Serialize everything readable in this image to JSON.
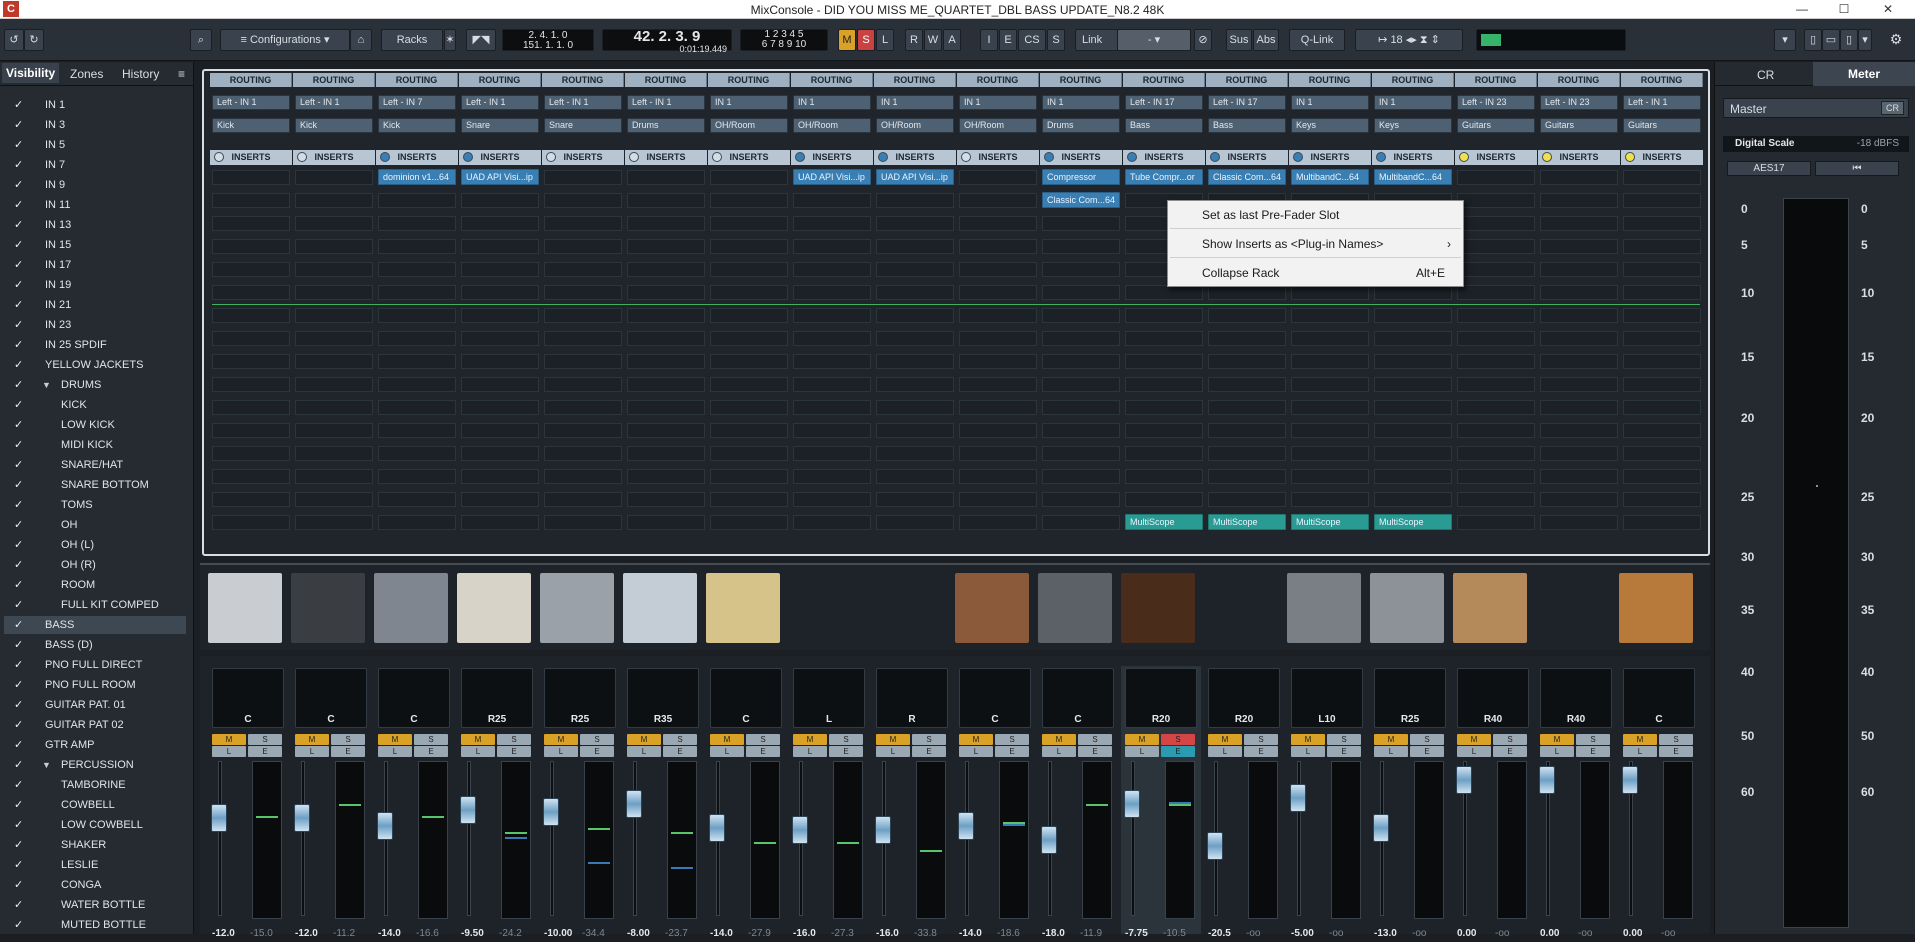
{
  "window": {
    "title": "MixConsole - DID YOU MISS ME_QUARTET_DBL BASS UPDATE_N8.2 48K",
    "minimize": "—",
    "maximize": "☐",
    "close": "✕"
  },
  "toolbar": {
    "configurations": "Configurations",
    "racks": "Racks",
    "pos1": "2. 4. 1.   0",
    "pos2": "151. 1. 1.   0",
    "bars": "42. 2. 3.   9",
    "time": "0:01:19.449",
    "nums1": "1 2 3 4 5",
    "nums2": "6 7 8 9 10",
    "m": "M",
    "s": "S",
    "l": "L",
    "r": "R",
    "w": "W",
    "a": "A",
    "i": "I",
    "e": "E",
    "cs": "CS",
    "s2": "S",
    "link": "Link",
    "linkval": "-",
    "sus": "Sus",
    "abs": "Abs",
    "qlink": "Q-Link",
    "zoom": "18"
  },
  "left_tabs": {
    "visibility": "Visibility",
    "zones": "Zones",
    "history": "History"
  },
  "tracks": [
    {
      "name": "IN 1",
      "c": "✓"
    },
    {
      "name": "IN 3",
      "c": "✓"
    },
    {
      "name": "IN 5",
      "c": "✓"
    },
    {
      "name": "IN 7",
      "c": "✓"
    },
    {
      "name": "IN 9",
      "c": "✓"
    },
    {
      "name": "IN 11",
      "c": "✓"
    },
    {
      "name": "IN 13",
      "c": "✓"
    },
    {
      "name": "IN 15",
      "c": "✓"
    },
    {
      "name": "IN 17",
      "c": "✓"
    },
    {
      "name": "IN 19",
      "c": "✓"
    },
    {
      "name": "IN 21",
      "c": "✓"
    },
    {
      "name": "IN 23",
      "c": "✓"
    },
    {
      "name": "IN 25   SPDIF",
      "c": "✓"
    },
    {
      "name": "YELLOW JACKETS",
      "c": "✓"
    },
    {
      "name": "DRUMS",
      "c": "✓",
      "fold": true
    },
    {
      "name": "KICK",
      "c": "✓",
      "sub": true
    },
    {
      "name": "LOW KICK",
      "c": "✓",
      "sub": true
    },
    {
      "name": "MIDI KICK",
      "c": "✓",
      "sub": true
    },
    {
      "name": "SNARE/HAT",
      "c": "✓",
      "sub": true
    },
    {
      "name": "SNARE BOTTOM",
      "c": "✓",
      "sub": true
    },
    {
      "name": "TOMS",
      "c": "✓",
      "sub": true
    },
    {
      "name": "OH",
      "c": "✓",
      "sub": true
    },
    {
      "name": "OH (L)",
      "c": "✓",
      "sub": true
    },
    {
      "name": "OH (R)",
      "c": "✓",
      "sub": true
    },
    {
      "name": "ROOM",
      "c": "✓",
      "sub": true
    },
    {
      "name": "FULL KIT COMPED",
      "c": "✓",
      "sub": true
    },
    {
      "name": "BASS",
      "c": "✓",
      "sel": true
    },
    {
      "name": "BASS (D)",
      "c": "✓"
    },
    {
      "name": "PNO FULL DIRECT",
      "c": "✓"
    },
    {
      "name": "PNO FULL  ROOM",
      "c": "✓"
    },
    {
      "name": "GUITAR PAT. 01",
      "c": "✓"
    },
    {
      "name": "GUITAR PAT 02",
      "c": "✓"
    },
    {
      "name": "GTR AMP",
      "c": "✓"
    },
    {
      "name": "PERCUSSION",
      "c": "✓",
      "fold": true
    },
    {
      "name": "TAMBORINE",
      "c": "✓",
      "sub": true
    },
    {
      "name": "COWBELL",
      "c": "✓",
      "sub": true
    },
    {
      "name": "LOW COWBELL",
      "c": "✓",
      "sub": true
    },
    {
      "name": "SHAKER",
      "c": "✓",
      "sub": true
    },
    {
      "name": "LESLIE",
      "c": "✓",
      "sub": true
    },
    {
      "name": "CONGA",
      "c": "✓",
      "sub": true
    },
    {
      "name": "WATER BOTTLE",
      "c": "✓",
      "sub": true
    },
    {
      "name": "MUTED BOTTLE",
      "c": "✓",
      "sub": true
    }
  ],
  "routing_label": "ROUTING",
  "inserts_label": "INSERTS",
  "channels": [
    {
      "in": "Left - IN 1",
      "name": "Kick",
      "pan": "C",
      "vol": "-12.0",
      "peak": "-15.0",
      "ins": "off"
    },
    {
      "in": "Left - IN 1",
      "name": "Kick",
      "pan": "C",
      "vol": "-12.0",
      "peak": "-11.2",
      "ins": "off"
    },
    {
      "in": "Left - IN 7",
      "name": "Kick",
      "pan": "C",
      "vol": "-14.0",
      "peak": "-16.6",
      "ins": "on"
    },
    {
      "in": "Left - IN 1",
      "name": "Snare",
      "pan": "R25",
      "vol": "-9.50",
      "peak": "-24.2",
      "ins": "on"
    },
    {
      "in": "Left - IN 1",
      "name": "Snare",
      "pan": "R25",
      "vol": "-10.00",
      "peak": "-34.4",
      "ins": "off"
    },
    {
      "in": "Left - IN 1",
      "name": "Drums",
      "pan": "R35",
      "vol": "-8.00",
      "peak": "-23.7",
      "ins": "off"
    },
    {
      "in": "IN 1",
      "name": "OH/Room",
      "pan": "C",
      "vol": "-14.0",
      "peak": "-27.9",
      "ins": "off"
    },
    {
      "in": "IN 1",
      "name": "OH/Room",
      "pan": "L",
      "vol": "-16.0",
      "peak": "-27.3",
      "ins": "on"
    },
    {
      "in": "IN 1",
      "name": "OH/Room",
      "pan": "R",
      "vol": "-16.0",
      "peak": "-33.8",
      "ins": "on"
    },
    {
      "in": "IN 1",
      "name": "OH/Room",
      "pan": "C",
      "vol": "-14.0",
      "peak": "-18.6",
      "ins": "off"
    },
    {
      "in": "IN 1",
      "name": "Drums",
      "pan": "C",
      "vol": "-18.0",
      "peak": "-11.9",
      "ins": "on"
    },
    {
      "in": "Left - IN 17",
      "name": "Bass",
      "pan": "R20",
      "vol": "-7.75",
      "peak": "-10.5",
      "ins": "on"
    },
    {
      "in": "Left - IN 17",
      "name": "Bass",
      "pan": "R20",
      "vol": "-20.5",
      "peak": "-oo",
      "ins": "on"
    },
    {
      "in": "IN 1",
      "name": "Keys",
      "pan": "L10",
      "vol": "-5.00",
      "peak": "-oo",
      "ins": "on"
    },
    {
      "in": "IN 1",
      "name": "Keys",
      "pan": "R25",
      "vol": "-13.0",
      "peak": "-oo",
      "ins": "on"
    },
    {
      "in": "Left - IN 23",
      "name": "Guitars",
      "pan": "R40",
      "vol": "0.00",
      "peak": "-oo",
      "ins": "yel"
    },
    {
      "in": "Left - IN 23",
      "name": "Guitars",
      "pan": "R40",
      "vol": "0.00",
      "peak": "-oo",
      "ins": "yel"
    },
    {
      "in": "Left - IN 1",
      "name": "Guitars",
      "pan": "C",
      "vol": "0.00",
      "peak": "-oo",
      "ins": "yel"
    }
  ],
  "plugins": [
    {
      "ch": 2,
      "slot": 0,
      "name": "dominion v1...64",
      "teal": false
    },
    {
      "ch": 3,
      "slot": 0,
      "name": "UAD API Visi...ip",
      "teal": false
    },
    {
      "ch": 7,
      "slot": 0,
      "name": "UAD API Visi...ip",
      "teal": false
    },
    {
      "ch": 8,
      "slot": 0,
      "name": "UAD API Visi...ip",
      "teal": false
    },
    {
      "ch": 10,
      "slot": 0,
      "name": "Compressor",
      "teal": false
    },
    {
      "ch": 10,
      "slot": 1,
      "name": "Classic Com...64",
      "teal": false
    },
    {
      "ch": 11,
      "slot": 0,
      "name": "Tube Compr...or",
      "teal": false
    },
    {
      "ch": 12,
      "slot": 0,
      "name": "Classic Com...64",
      "teal": false
    },
    {
      "ch": 13,
      "slot": 0,
      "name": "MultibandC...64",
      "teal": false
    },
    {
      "ch": 14,
      "slot": 0,
      "name": "MultibandC...64",
      "teal": false
    },
    {
      "ch": 11,
      "slot": 15,
      "name": "MultiScope",
      "teal": true
    },
    {
      "ch": 12,
      "slot": 15,
      "name": "MultiScope",
      "teal": true
    },
    {
      "ch": 13,
      "slot": 15,
      "name": "MultiScope",
      "teal": true
    },
    {
      "ch": 14,
      "slot": 15,
      "name": "MultiScope",
      "teal": true
    }
  ],
  "context_menu": {
    "item1": "Set as last Pre-Fader Slot",
    "item2": "Show Inserts as <Plug-in Names>",
    "item2_arrow": "›",
    "item3": "Collapse Rack",
    "item3_shortcut": "Alt+E"
  },
  "fader_buttons": {
    "m": "M",
    "s": "S",
    "l": "L",
    "e": "E"
  },
  "right_panel": {
    "tab_cr": "CR",
    "tab_meter": "Meter",
    "master": "Master",
    "cr_btn": "CR",
    "digital_scale": "Digital Scale",
    "dbfs": "-18 dBFS",
    "aes": "AES17",
    "reset": "⏮",
    "scale": [
      "0",
      "5",
      "10",
      "15",
      "20",
      "25",
      "30",
      "35",
      "40",
      "50",
      "60"
    ]
  }
}
